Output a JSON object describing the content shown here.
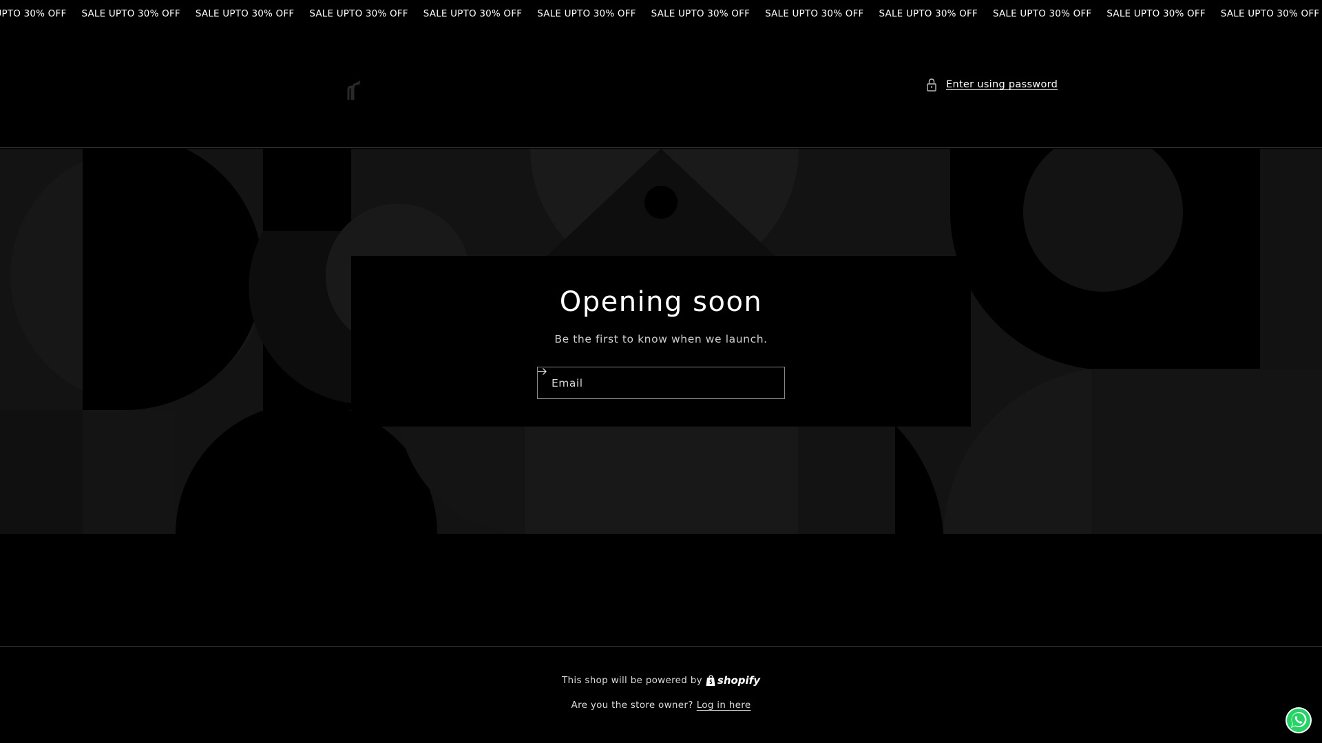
{
  "announcement": {
    "text": "SALE UPTO 30% OFF",
    "repeat_count": 14
  },
  "header": {
    "logo_icon": "brand-logo-icon",
    "password_link": "Enter using password",
    "password_icon": "lock-icon"
  },
  "hero": {
    "title": "Opening soon",
    "subtitle": "Be the first to know when we launch.",
    "email_placeholder": "Email",
    "submit_icon": "arrow-right-icon"
  },
  "footer": {
    "powered_text": "This shop will be powered by",
    "powered_brand": "shopify",
    "owner_text": "Are you the store owner?",
    "login_link": "Log in here"
  },
  "chat_widget": {
    "icon": "whatsapp-icon",
    "color": "#25D366"
  },
  "colors": {
    "background": "#000000",
    "banner_light": "#131313",
    "banner_mid": "#191919",
    "text": "#ffffff"
  }
}
